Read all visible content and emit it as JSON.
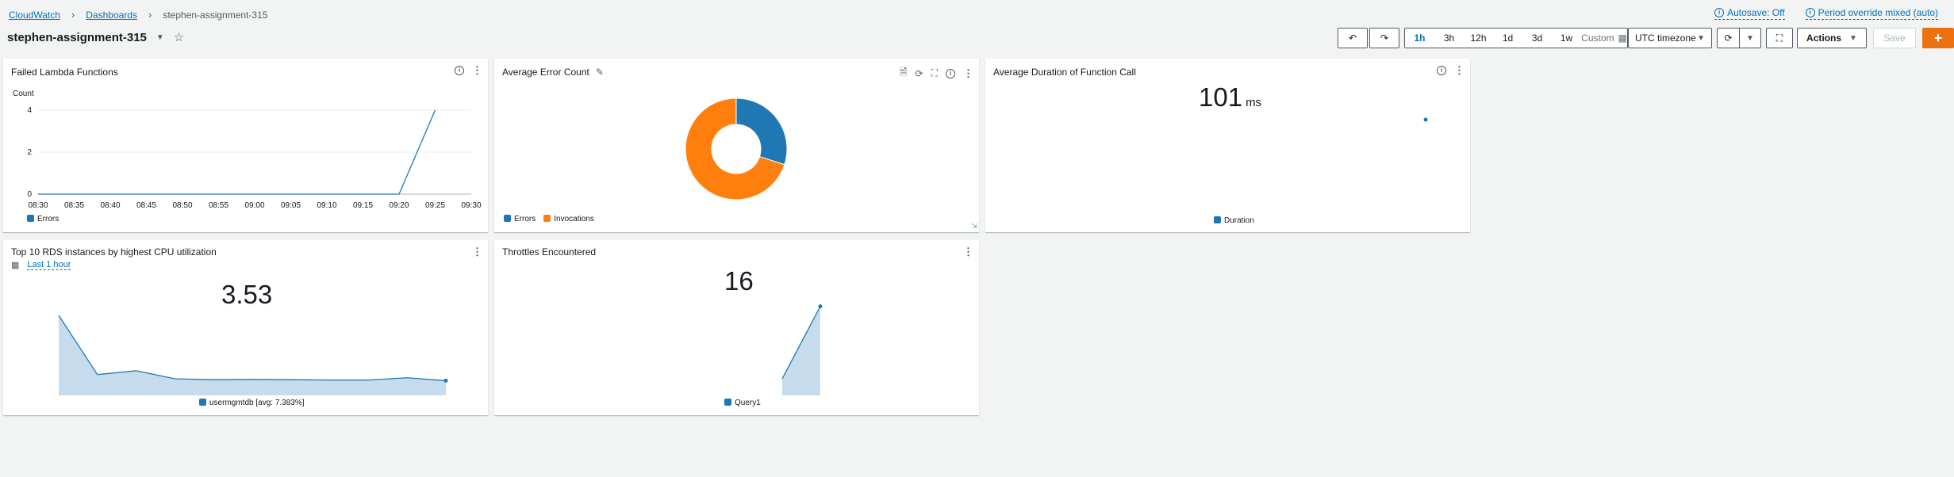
{
  "breadcrumb": {
    "root": "CloudWatch",
    "dashboards": "Dashboards",
    "current": "stephen-assignment-315"
  },
  "dashboard": {
    "title": "stephen-assignment-315"
  },
  "header_links": {
    "autosave": "Autosave: Off",
    "period_override": "Period override mixed (auto)"
  },
  "toolbar": {
    "ranges": [
      "1h",
      "3h",
      "12h",
      "1d",
      "3d",
      "1w"
    ],
    "active_range": "1h",
    "custom": "Custom",
    "timezone": "UTC timezone",
    "actions": "Actions",
    "save": "Save",
    "add": "+"
  },
  "colors": {
    "blue": "#1f77b4",
    "orange": "#ff7f0e",
    "accent": "#ec7211",
    "link": "#0073bb"
  },
  "widgets": {
    "failed_lambda": {
      "title": "Failed Lambda Functions"
    },
    "avg_error": {
      "title": "Average Error Count"
    },
    "avg_duration": {
      "title": "Average Duration of Function Call",
      "value": "101",
      "unit": "ms",
      "legend": "Duration"
    },
    "rds_cpu": {
      "title": "Top 10 RDS instances by highest CPU utilization",
      "time_link": "Last 1 hour",
      "value": "3.53",
      "legend": "usermgmtdb [avg: 7.383%]"
    },
    "throttles": {
      "title": "Throttles Encountered",
      "value": "16",
      "legend": "Query1"
    }
  },
  "chart_data": [
    {
      "type": "line",
      "title": "Failed Lambda Functions",
      "ylabel": "Count",
      "ylim": [
        0,
        4
      ],
      "yticks": [
        "4",
        "2",
        "0"
      ],
      "x": [
        "08:30",
        "08:35",
        "08:40",
        "08:45",
        "08:50",
        "08:55",
        "09:00",
        "09:05",
        "09:10",
        "09:15",
        "09:20",
        "09:25",
        "09:30"
      ],
      "series": [
        {
          "name": "Errors",
          "values": [
            0,
            0,
            0,
            0,
            0,
            0,
            0,
            0,
            0,
            0,
            0,
            4,
            null
          ]
        }
      ],
      "grid": true,
      "legend": "bottom-left"
    },
    {
      "type": "pie",
      "title": "Average Error Count",
      "donut": true,
      "series": [
        {
          "name": "Errors",
          "value": 30
        },
        {
          "name": "Invocations",
          "value": 70
        }
      ],
      "legend": "bottom-left"
    },
    {
      "type": "area",
      "title": "Top 10 RDS instances by highest CPU utilization",
      "series": [
        {
          "name": "usermgmtdb [avg: 7.383%]",
          "values": [
            25,
            6.5,
            7.7,
            5.2,
            4.9,
            5.0,
            4.9,
            4.8,
            4.8,
            5.5,
            4.6
          ]
        }
      ],
      "legend": "bottom-center"
    },
    {
      "type": "area",
      "title": "Throttles Encountered",
      "series": [
        {
          "name": "Query1",
          "values": [
            3,
            16
          ]
        }
      ],
      "legend": "bottom-center"
    }
  ]
}
